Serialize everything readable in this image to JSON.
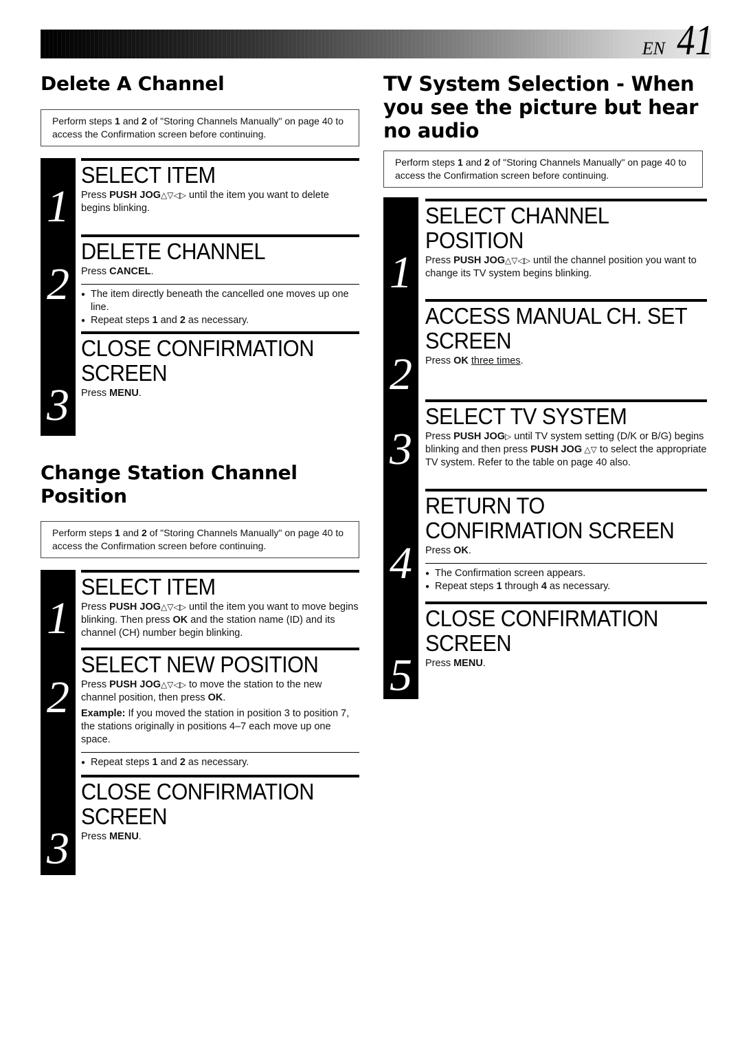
{
  "header": {
    "lang_code": "EN",
    "page_number": "41"
  },
  "left": {
    "delete_channel": {
      "title": "Delete A Channel",
      "note": {
        "pre1": "Perform steps ",
        "s1": "1",
        "mid": " and ",
        "s2": "2",
        "post": " of \"Storing Channels Manually\" on page 40 to access the Confirmation screen before continuing."
      },
      "steps": [
        {
          "number": "1",
          "title": "SELECT ITEM",
          "text_pre": "Press ",
          "text_bold": "PUSH JOG",
          "arrows": "△▽◁▷",
          "text_post": " until the item you want to delete begins blinking."
        },
        {
          "number": "2",
          "title": "DELETE CHANNEL",
          "text_pre": "Press ",
          "text_bold": "CANCEL",
          "text_post": ".",
          "bullets": [
            {
              "text": "The item directly beneath the cancelled one moves up one line."
            },
            {
              "pre": "Repeat steps ",
              "b1": "1",
              "mid": " and ",
              "b2": "2",
              "post": " as necessary."
            }
          ]
        },
        {
          "number": "3",
          "title_line1": "CLOSE CONFIRMATION",
          "title_line2": "SCREEN",
          "text_pre": "Press ",
          "text_bold": "MENU",
          "text_post": "."
        }
      ]
    },
    "change_position": {
      "title_line1": "Change Station Channel",
      "title_line2": "Position",
      "note": {
        "pre1": "Perform steps ",
        "s1": "1",
        "mid": " and ",
        "s2": "2",
        "post": " of \"Storing Channels Manually\" on page 40 to access the Confirmation screen before continuing."
      },
      "steps": [
        {
          "number": "1",
          "title": "SELECT ITEM",
          "text_pre": "Press ",
          "text_bold": "PUSH JOG",
          "arrows": "△▽◁▷",
          "text_mid": " until the item you want to move begins blinking. Then press ",
          "text_bold2": "OK",
          "text_post": " and the station name (ID) and its channel (CH) number begin blinking."
        },
        {
          "number": "2",
          "title": "SELECT NEW POSITION",
          "text_pre": "Press ",
          "text_bold": "PUSH JOG",
          "arrows": "△▽◁▷",
          "text_mid": " to move the station to the new channel position, then press ",
          "text_bold2": "OK",
          "text_post": ".",
          "example_label": "Example:",
          "example_text": "  If you moved the station in position 3 to position 7, the stations originally in positions 4–7 each move up one space.",
          "bullets": [
            {
              "pre": "Repeat steps ",
              "b1": "1",
              "mid": " and ",
              "b2": "2",
              "post": " as necessary."
            }
          ]
        },
        {
          "number": "3",
          "title_line1": "CLOSE CONFIRMATION",
          "title_line2": "SCREEN",
          "text_pre": "Press ",
          "text_bold": "MENU",
          "text_post": "."
        }
      ]
    }
  },
  "right": {
    "tv_system": {
      "title_line1": "TV System Selection - When",
      "title_line2": "you see the picture but hear",
      "title_line3": "no audio",
      "note": {
        "pre1": "Perform steps ",
        "s1": "1",
        "mid": " and ",
        "s2": "2",
        "post": " of \"Storing Channels Manually\" on page 40 to access the Confirmation screen before continuing."
      },
      "steps": [
        {
          "number": "1",
          "title_line1": "SELECT CHANNEL",
          "title_line2": "POSITION",
          "text_pre": "Press ",
          "text_bold": "PUSH JOG",
          "arrows": "△▽◁▷",
          "text_post": " until the channel position you want to change its TV system begins blinking."
        },
        {
          "number": "2",
          "title_line1": "ACCESS MANUAL CH. SET",
          "title_line2": "SCREEN",
          "text_pre": "Press ",
          "text_bold": "OK",
          "text_underline": "three times",
          "text_post": "."
        },
        {
          "number": "3",
          "title": "SELECT TV SYSTEM",
          "text_pre": "Press ",
          "text_bold": "PUSH JOG",
          "arrow1": "▷",
          "text_mid": " until TV system setting (D/K or B/G) begins blinking and then press ",
          "text_bold2": "PUSH JOG",
          "arrow2": " △▽",
          "text_post": " to select the appropriate TV system. Refer to the table on page 40 also."
        },
        {
          "number": "4",
          "title_line1": "RETURN TO",
          "title_line2": "CONFIRMATION SCREEN",
          "text_pre": "Press ",
          "text_bold": "OK",
          "text_post": ".",
          "bullets": [
            {
              "text": "The Confirmation screen appears."
            },
            {
              "pre": "Repeat steps ",
              "b1": "1",
              "mid": " through ",
              "b2": "4",
              "post": " as necessary."
            }
          ]
        },
        {
          "number": "5",
          "title_line1": "CLOSE CONFIRMATION",
          "title_line2": "SCREEN",
          "text_pre": "Press ",
          "text_bold": "MENU",
          "text_post": "."
        }
      ]
    }
  }
}
